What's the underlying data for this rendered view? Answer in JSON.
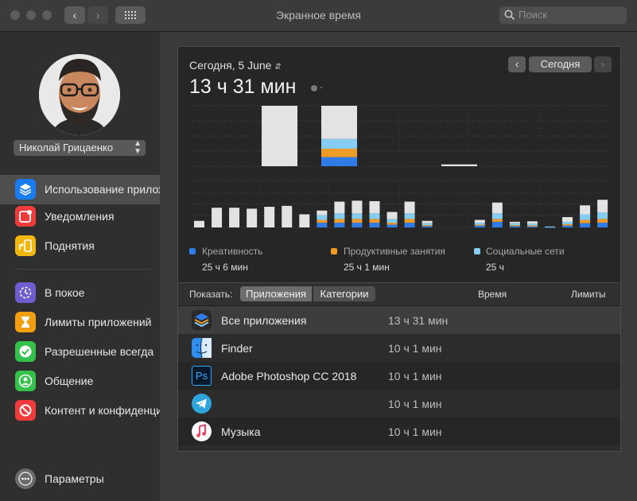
{
  "window": {
    "title": "Экранное время"
  },
  "toolbar": {
    "back": "‹",
    "forward": "›",
    "search_placeholder": "Поиск"
  },
  "user": {
    "name": "Николай Грицаенко"
  },
  "sidebar": {
    "items": [
      {
        "label": "Использование приложений",
        "icon": "layers-icon",
        "color": "#1a7cf2",
        "selected": true
      },
      {
        "label": "Уведомления",
        "icon": "notification-icon",
        "color": "#f23b3b"
      },
      {
        "label": "Поднятия",
        "icon": "pickups-icon",
        "color": "#f2b80f"
      },
      {
        "label": "В покое",
        "icon": "downtime-icon",
        "color": "#6f5ccf"
      },
      {
        "label": "Лимиты приложений",
        "icon": "hourglass-icon",
        "color": "#f29f0f"
      },
      {
        "label": "Разрешенные всегда",
        "icon": "checkmark-badge-icon",
        "color": "#34c24a"
      },
      {
        "label": "Общение",
        "icon": "contact-icon",
        "color": "#34c24a"
      },
      {
        "label": "Контент и конфиденциальность",
        "icon": "restriction-icon",
        "color": "#f23b3b"
      }
    ],
    "settings_label": "Параметры"
  },
  "usage": {
    "date": "Сегодня, 5 June",
    "total": "13 ч 31 мин",
    "dash": "-",
    "today_button": "Сегодня"
  },
  "colors": {
    "creativity": "#2f7ce8",
    "productivity": "#ef9b2a",
    "social": "#86cdf2",
    "other": "#e3e3e3"
  },
  "chart_data": {
    "type": "bar",
    "stacked": true,
    "daily": {
      "categories": [
        "d1",
        "d2",
        "d3",
        "d4"
      ],
      "series": [
        {
          "key": "other",
          "values": [
            100,
            55,
            0,
            3
          ]
        },
        {
          "key": "social",
          "values": [
            0,
            16,
            0,
            0
          ]
        },
        {
          "key": "productivity",
          "values": [
            0,
            14,
            0,
            0
          ]
        },
        {
          "key": "creativity",
          "values": [
            0,
            15,
            0,
            0
          ]
        }
      ],
      "ylim": [
        0,
        100
      ]
    },
    "hourly": {
      "series": [
        {
          "key": "other",
          "values": [
            14,
            42,
            42,
            40,
            44,
            46,
            28,
            10,
            25,
            27,
            26,
            15,
            25,
            5,
            0,
            0,
            6,
            23,
            3,
            5,
            0,
            10,
            19,
            27
          ]
        },
        {
          "key": "social",
          "values": [
            0,
            0,
            0,
            0,
            0,
            0,
            0,
            10,
            12,
            12,
            12,
            8,
            12,
            4,
            0,
            0,
            4,
            12,
            4,
            4,
            1,
            5,
            12,
            14
          ]
        },
        {
          "key": "productivity",
          "values": [
            0,
            0,
            0,
            0,
            0,
            0,
            0,
            6,
            8,
            8,
            8,
            4,
            8,
            2,
            0,
            0,
            2,
            6,
            2,
            2,
            0,
            3,
            7,
            8
          ]
        },
        {
          "key": "creativity",
          "values": [
            0,
            0,
            0,
            0,
            0,
            0,
            0,
            10,
            10,
            10,
            10,
            6,
            10,
            3,
            0,
            0,
            4,
            12,
            3,
            2,
            1,
            4,
            9,
            10
          ]
        }
      ],
      "ylim": [
        0,
        100
      ]
    },
    "legend": [
      {
        "name": "Креативность",
        "value": "25 ч 6 мин",
        "color_key": "creativity"
      },
      {
        "name": "Продуктивные занятия",
        "value": "25 ч 1 мин",
        "color_key": "productivity"
      },
      {
        "name": "Социальные сети",
        "value": "25 ч",
        "color_key": "social"
      }
    ]
  },
  "list": {
    "show_label": "Показать:",
    "tab_apps": "Приложения",
    "tab_categories": "Категории",
    "col_time": "Время",
    "col_limits": "Лимиты",
    "rows": [
      {
        "name": "Все приложения",
        "time": "13 ч 31 мин",
        "icon": "layers-icon"
      },
      {
        "name": "Finder",
        "time": "10 ч 1 мин",
        "icon": "finder-icon"
      },
      {
        "name": "Adobe Photoshop CC 2018",
        "time": "10 ч 1 мин",
        "icon": "photoshop-icon",
        "icon_text": "Ps"
      },
      {
        "name": "",
        "time": "10 ч 1 мин",
        "icon": "telegram-icon"
      },
      {
        "name": "Музыка",
        "time": "10 ч 1 мин",
        "icon": "music-icon"
      }
    ]
  }
}
